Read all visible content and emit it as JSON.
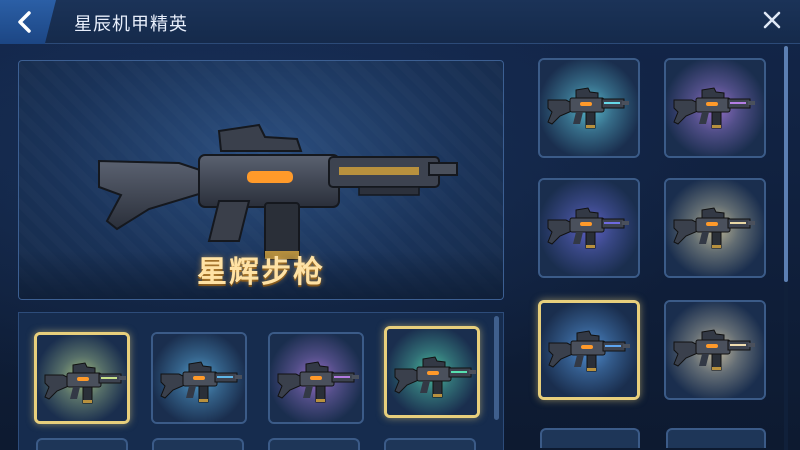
{
  "header": {
    "title": "星辰机甲精英"
  },
  "preview": {
    "weapon_name": "星辉步枪"
  },
  "grid_tiles": [
    {
      "id": "bottom-1",
      "glow": "#c7e08a",
      "selected": true
    },
    {
      "id": "bottom-2",
      "glow": "#5fb6e8",
      "selected": false
    },
    {
      "id": "bottom-3",
      "glow": "#b37ae0",
      "selected": false
    },
    {
      "id": "bottom-4",
      "glow": "#57e0b0",
      "selected": true
    }
  ],
  "side_tiles": [
    {
      "id": "side-1",
      "glow": "#66d8e8",
      "selected": false
    },
    {
      "id": "side-2",
      "glow": "#b47ee6",
      "selected": false
    },
    {
      "id": "side-3",
      "glow": "#6e6ae0",
      "selected": false
    },
    {
      "id": "side-4",
      "glow": "#e8d8a6",
      "selected": false
    },
    {
      "id": "side-5",
      "glow": "#5da4f0",
      "selected": true
    },
    {
      "id": "side-6",
      "glow": "#efdcb0",
      "selected": false
    }
  ],
  "colors": {
    "accent_gold": "#e8cf7c",
    "name_text": "#ffe2a4",
    "panel_border": "#3c5f92"
  },
  "icons": {
    "back": "chevron-left-icon",
    "close": "close-icon",
    "weapon": "rifle-icon"
  }
}
